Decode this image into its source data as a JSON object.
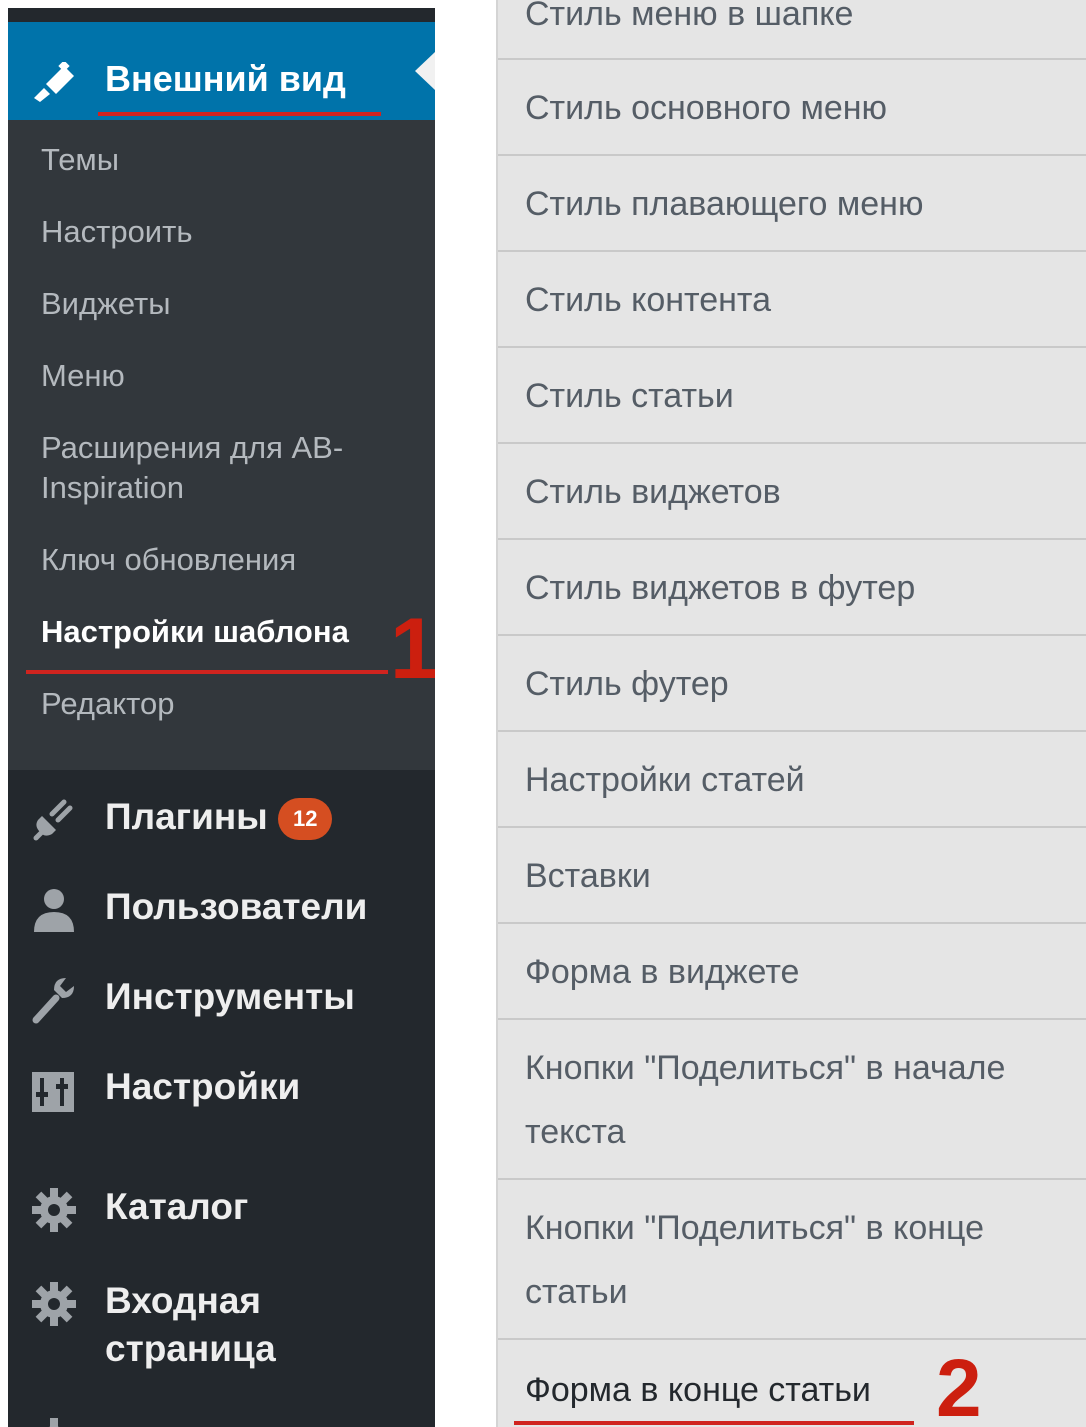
{
  "sidebar": {
    "section_title": "Внешний вид",
    "submenu": [
      "Темы",
      "Настроить",
      "Виджеты",
      "Меню",
      "Расширения для AB-",
      "Inspiration",
      "Ключ обновления",
      "Настройки шаблона",
      "Редактор"
    ],
    "menu": [
      {
        "label": "Плагины",
        "icon": "plugin-icon",
        "badge": "12"
      },
      {
        "label": "Пользователи",
        "icon": "users-icon"
      },
      {
        "label": "Инструменты",
        "icon": "wrench-icon"
      },
      {
        "label": "Настройки",
        "icon": "settings-sliders-icon"
      },
      {
        "label": "Каталог",
        "icon": "gear-icon"
      },
      {
        "label": "Входная",
        "icon": "gear-icon"
      },
      {
        "label": "страница"
      }
    ]
  },
  "settings_menu": {
    "items": [
      "Стиль меню в шапке",
      "Стиль основного меню",
      "Стиль плавающего меню",
      "Стиль контента",
      "Стиль статьи",
      "Стиль виджетов",
      "Стиль виджетов в футер",
      "Стиль футер",
      "Настройки статей",
      "Вставки",
      "Форма в виджете",
      "Кнопки \"Поделиться\" в начале",
      "текста",
      "Кнопки \"Поделиться\" в конце",
      "статьи",
      "Форма в конце статьи"
    ]
  },
  "annotations": {
    "step1": "1",
    "step2": "2"
  },
  "colors": {
    "sidebar_bg": "#23282d",
    "submenu_bg": "#32373c",
    "accent": "#0073aa",
    "highlight_red": "#d0241f",
    "badge": "#d54e21",
    "settings_bg": "#e5e5e5"
  }
}
